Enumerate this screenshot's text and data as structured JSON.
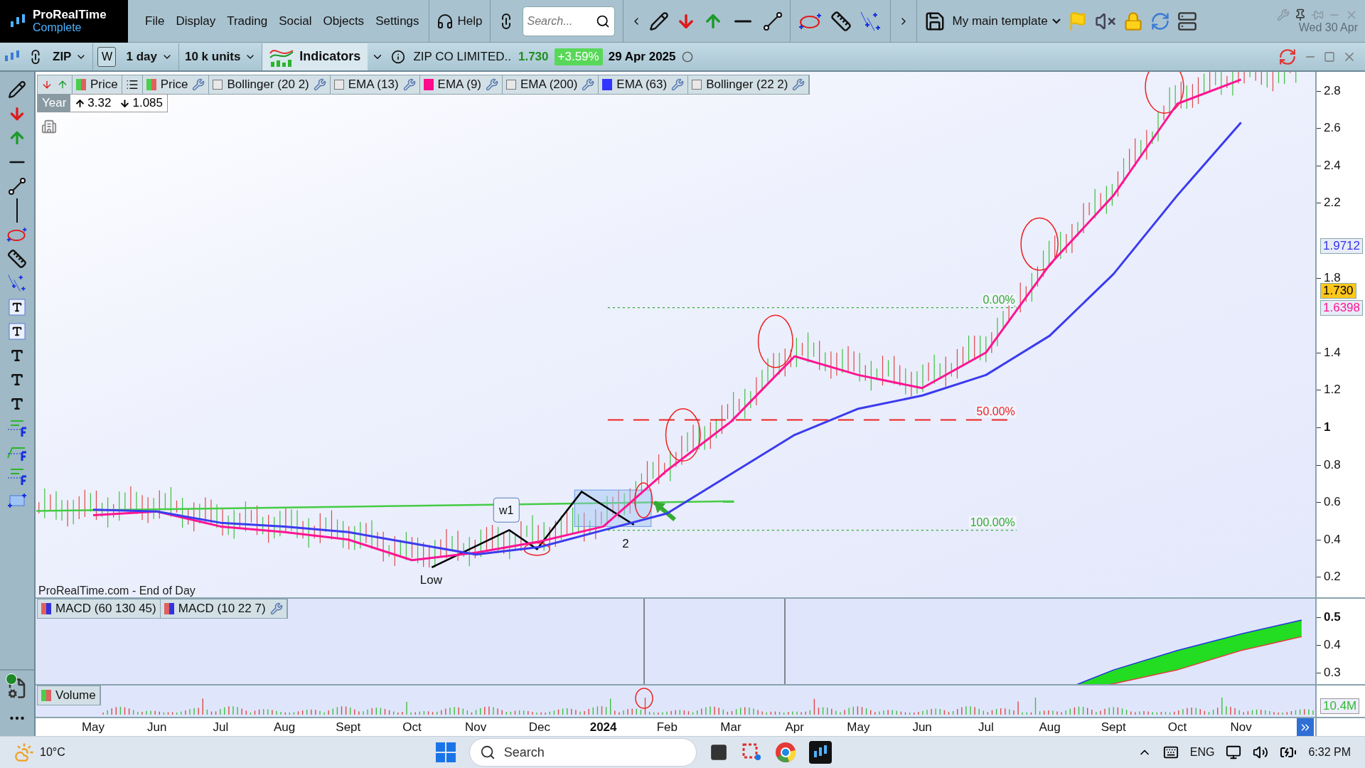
{
  "app": {
    "name": "ProRealTime",
    "edition": "Complete"
  },
  "menu": [
    "File",
    "Display",
    "Trading",
    "Social",
    "Objects",
    "Settings"
  ],
  "help": "Help",
  "search": {
    "placeholder": "Search..."
  },
  "template": "My main template",
  "clock_date": "Wed 30 Apr",
  "chart_toolbar": {
    "symbol": "ZIP",
    "week_key": "W",
    "period": "1 day",
    "units": "10 k units",
    "indicators": "Indicators",
    "instrument": "ZIP CO LIMITED..",
    "price": "1.730",
    "change": "+3.59%",
    "date": "29 Apr 2025"
  },
  "legend": [
    {
      "kind": "price",
      "label": "Price",
      "wrench": false
    },
    {
      "kind": "price",
      "label": "Price",
      "wrench": true
    },
    {
      "kind": "checkbox",
      "label": "Bollinger (20 2)",
      "checked": false,
      "wrench": true
    },
    {
      "kind": "checkbox",
      "label": "EMA (13)",
      "checked": false,
      "wrench": true
    },
    {
      "kind": "color",
      "label": "EMA (9)",
      "color": "#ff0a8c",
      "wrench": true
    },
    {
      "kind": "checkbox",
      "label": "EMA (200)",
      "checked": false,
      "wrench": true
    },
    {
      "kind": "color",
      "label": "EMA (63)",
      "color": "#3333ff",
      "wrench": true
    },
    {
      "kind": "checkbox",
      "label": "Bollinger (22 2)",
      "checked": false,
      "wrench": true
    }
  ],
  "range": {
    "period": "Year",
    "high": "3.32",
    "low": "1.085"
  },
  "source": "ProRealTime.com - End of Day",
  "chart_labels": [
    {
      "kind": "fib",
      "text": "0.00%",
      "color": "#33aa33"
    },
    {
      "kind": "fib",
      "text": "50.00%",
      "color": "#ee2222"
    },
    {
      "kind": "fib",
      "text": "100.00%",
      "color": "#33aa33"
    },
    {
      "kind": "plain",
      "text": "Low"
    },
    {
      "kind": "plain",
      "text": "2"
    },
    {
      "kind": "boxed",
      "text": "w1"
    }
  ],
  "price_axis": [
    {
      "kind": "minor",
      "label": "2.8"
    },
    {
      "kind": "minor",
      "label": "2.6"
    },
    {
      "kind": "minor",
      "label": "2.4"
    },
    {
      "kind": "minor",
      "label": "2.2"
    },
    {
      "kind": "minor",
      "label": "1.8"
    },
    {
      "kind": "minor",
      "label": "1.4"
    },
    {
      "kind": "minor",
      "label": "1.2"
    },
    {
      "kind": "major",
      "label": "1"
    },
    {
      "kind": "minor",
      "label": "0.8"
    },
    {
      "kind": "minor",
      "label": "0.6"
    },
    {
      "kind": "minor",
      "label": "0.4"
    },
    {
      "kind": "minor",
      "label": "0.2"
    }
  ],
  "price_tags": [
    {
      "kind": "plain",
      "text": "1.9712",
      "color": "#3333ee"
    },
    {
      "kind": "last",
      "text": "1.730"
    },
    {
      "kind": "plain",
      "text": "1.6398",
      "color": "#ff1493"
    }
  ],
  "macd": {
    "legend": [
      {
        "label": "MACD (60 130 45)",
        "wrench": false
      },
      {
        "label": "MACD (10 22 7)",
        "wrench": true
      }
    ],
    "axis": [
      {
        "kind": "major",
        "label": "0.5"
      },
      {
        "kind": "minor",
        "label": "0.4"
      },
      {
        "kind": "minor",
        "label": "0.3"
      }
    ]
  },
  "volume": {
    "label": "Volume",
    "tag": "10.4M"
  },
  "date_axis": [
    {
      "kind": "month",
      "label": "May"
    },
    {
      "kind": "month",
      "label": "Jun"
    },
    {
      "kind": "month",
      "label": "Jul"
    },
    {
      "kind": "month",
      "label": "Aug"
    },
    {
      "kind": "month",
      "label": "Sept"
    },
    {
      "kind": "month",
      "label": "Oct"
    },
    {
      "kind": "month",
      "label": "Nov"
    },
    {
      "kind": "month",
      "label": "Dec"
    },
    {
      "kind": "year",
      "label": "2024"
    },
    {
      "kind": "month",
      "label": "Feb"
    },
    {
      "kind": "month",
      "label": "Mar"
    },
    {
      "kind": "month",
      "label": "Apr"
    },
    {
      "kind": "month",
      "label": "May"
    },
    {
      "kind": "month",
      "label": "Jun"
    },
    {
      "kind": "month",
      "label": "Jul"
    },
    {
      "kind": "month",
      "label": "Aug"
    },
    {
      "kind": "month",
      "label": "Sept"
    },
    {
      "kind": "month",
      "label": "Oct"
    },
    {
      "kind": "month",
      "label": "Nov"
    }
  ],
  "taskbar": {
    "temperature": "10°C",
    "search": "Search",
    "language": "ENG",
    "time": "6:32 PM"
  }
}
